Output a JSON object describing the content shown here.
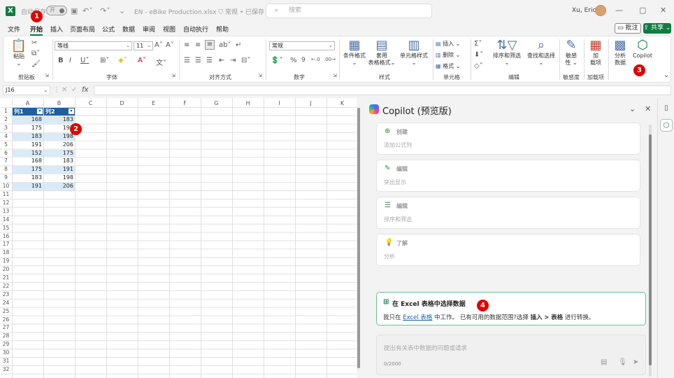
{
  "titlebar": {
    "app_icon": "X",
    "autosave_label": "自动保存",
    "autosave_state": "开",
    "filename": "EN - eBike Production.xlsx",
    "sensitivity": "常规",
    "save_status": "已保存",
    "search_placeholder": "搜索",
    "user_name": "Xu, Eric"
  },
  "menu": {
    "tabs": [
      "文件",
      "开始",
      "插入",
      "页面布局",
      "公式",
      "数据",
      "审阅",
      "视图",
      "自动执行",
      "帮助"
    ],
    "active_tab": "开始",
    "comment_button": "批注",
    "share_button": "共享"
  },
  "ribbon": {
    "clipboard": {
      "label": "剪贴板",
      "paste": "粘贴"
    },
    "font": {
      "label": "字体",
      "font_name": "等线",
      "font_size": "11"
    },
    "alignment": {
      "label": "对齐方式"
    },
    "number": {
      "label": "数字",
      "format": "常规"
    },
    "styles": {
      "label": "样式",
      "conditional": "条件格式",
      "table_format": "套用\n表格格式",
      "cell_styles": "单元格样式"
    },
    "cells": {
      "label": "单元格",
      "insert": "插入",
      "delete": "删除",
      "format": "格式"
    },
    "editing": {
      "label": "编辑",
      "sort_filter": "排序和筛选",
      "find_select": "查找和选择"
    },
    "sensitivity": {
      "label": "敏感度",
      "button": "敏感\n性"
    },
    "addins": {
      "label": "加载项",
      "button": "加\n载项"
    },
    "analyze": {
      "button": "分析\n数据"
    },
    "copilot": {
      "button": "Copilot"
    }
  },
  "formula_bar": {
    "name_box": "J16",
    "fx": "fx",
    "formula": ""
  },
  "sheet": {
    "columns": [
      "A",
      "B",
      "C",
      "D",
      "E",
      "F",
      "G",
      "H",
      "I",
      "J",
      "K"
    ],
    "rows": [
      "1",
      "2",
      "3",
      "4",
      "5",
      "6",
      "7",
      "8",
      "9",
      "10",
      "11",
      "12",
      "13",
      "14",
      "15",
      "16",
      "17",
      "18",
      "19",
      "20",
      "21",
      "22",
      "23",
      "24",
      "25",
      "26",
      "27",
      "28",
      "29",
      "30",
      "31",
      "32"
    ],
    "table": {
      "headers": [
        "列1",
        "列2"
      ],
      "data": [
        [
          "168",
          "183"
        ],
        [
          "175",
          "191"
        ],
        [
          "183",
          "198"
        ],
        [
          "191",
          "206"
        ],
        [
          "152",
          "175"
        ],
        [
          "168",
          "183"
        ],
        [
          "175",
          "191"
        ],
        [
          "183",
          "198"
        ],
        [
          "191",
          "206"
        ]
      ]
    }
  },
  "copilot": {
    "title": "Copilot (预览版)",
    "cards": [
      {
        "title": "创建",
        "subtitle": "添加公式列",
        "icon": "plus-circle-icon"
      },
      {
        "title": "编辑",
        "subtitle": "突出显示",
        "icon": "pencil-icon"
      },
      {
        "title": "编辑",
        "subtitle": "排序和筛选",
        "icon": "filter-icon"
      },
      {
        "title": "了解",
        "subtitle": "分析",
        "icon": "lightbulb-icon"
      }
    ],
    "info": {
      "title": "在 Excel 表格中选择数据",
      "text_1": "我只在",
      "link": "Excel 表格",
      "text_2": "中工作。 已有可用的数据范围?选择",
      "bold_1": "插入",
      "text_3": ">",
      "bold_2": "表格",
      "text_4": "进行转换。"
    },
    "input_placeholder": "提出有关表中数据的问题或请求",
    "char_count": "0/2000"
  },
  "callouts": [
    "1",
    "2",
    "3",
    "4"
  ],
  "colors": {
    "excel_green": "#107c41",
    "table_header": "#1f5f9c",
    "table_band": "#dbeaf7",
    "callout": "#e00000"
  }
}
